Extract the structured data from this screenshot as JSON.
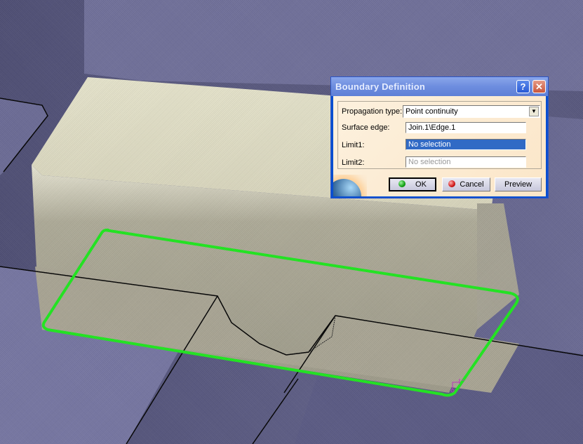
{
  "dialog": {
    "title": "Boundary Definition",
    "help_label": "?",
    "close_label": "✕",
    "propagation_type": {
      "label": "Propagation type:",
      "value": "Point continuity",
      "arrow": "▼"
    },
    "surface_edge": {
      "label": "Surface edge:",
      "value": "Join.1\\Edge.1"
    },
    "limit1": {
      "label": "Limit1:",
      "value": "No selection"
    },
    "limit2": {
      "label": "Limit2:",
      "value": "No selection"
    },
    "buttons": {
      "ok": "OK",
      "cancel": "Cancel",
      "preview": "Preview"
    }
  },
  "viewport": {
    "highlight_color": "#1ee81e",
    "background_color": "#55557a",
    "solid_color": "#d8d6c0"
  }
}
